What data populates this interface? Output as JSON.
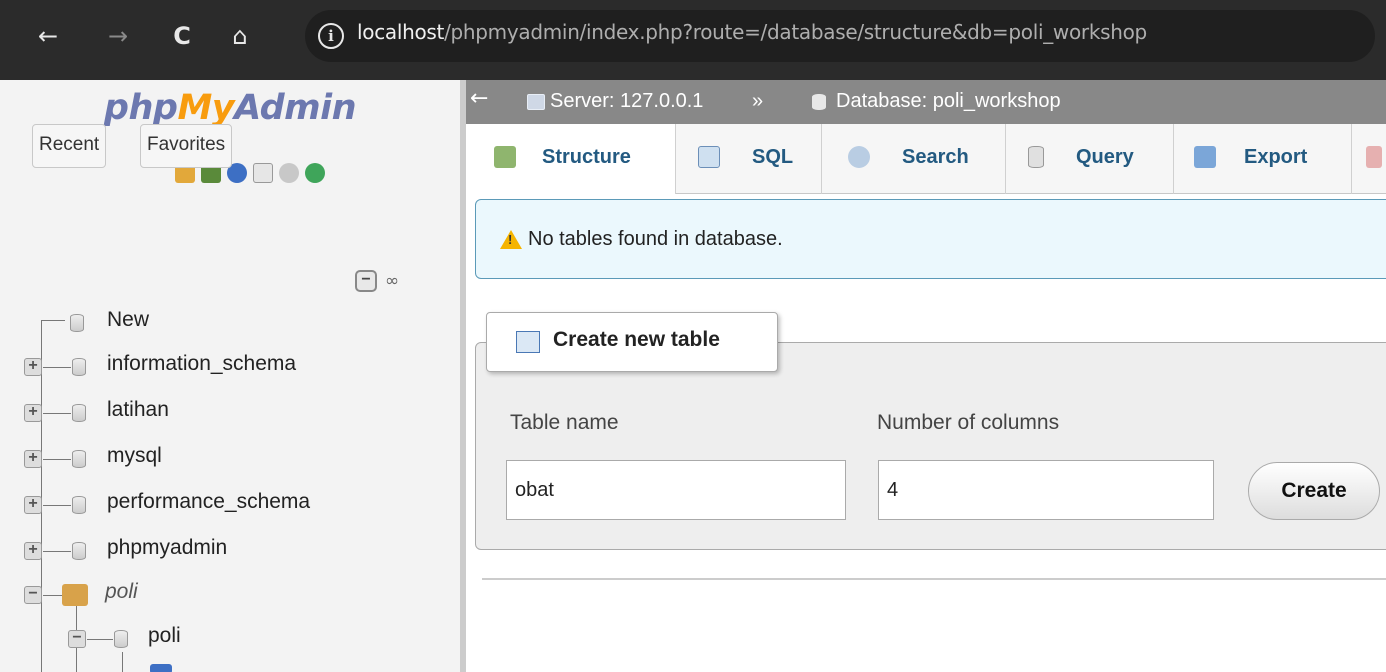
{
  "browser": {
    "back_icon": "←",
    "forward_icon": "→",
    "reload_icon": "C",
    "home_icon": "⌂",
    "info_icon": "i",
    "url_host": "localhost",
    "url_path": "/phpmyadmin/index.php?route=/database/structure&db=poli_workshop"
  },
  "sidebar": {
    "logo_php": "php",
    "logo_my": "My",
    "logo_admin": "Admin",
    "tabs": [
      {
        "label": "Recent"
      },
      {
        "label": "Favorites"
      }
    ],
    "collapse_label": "−",
    "link_label": "∞",
    "tree": [
      {
        "label": "New"
      },
      {
        "label": "information_schema"
      },
      {
        "label": "latihan"
      },
      {
        "label": "mysql"
      },
      {
        "label": "performance_schema"
      },
      {
        "label": "phpmyadmin"
      },
      {
        "label": "poli"
      },
      {
        "label": "poli"
      }
    ]
  },
  "breadcrumb": {
    "server": "Server: 127.0.0.1",
    "separator": "»",
    "database": "Database: poli_workshop"
  },
  "tabs": [
    {
      "label": "Structure",
      "active": true
    },
    {
      "label": "SQL"
    },
    {
      "label": "Search"
    },
    {
      "label": "Query"
    },
    {
      "label": "Export"
    }
  ],
  "notice": {
    "warning_mark": "!",
    "text": "No tables found in database."
  },
  "create_table": {
    "legend": "Create new table",
    "table_name_label": "Table name",
    "table_name_value": "obat",
    "columns_label": "Number of columns",
    "columns_value": "4",
    "create_button": "Create"
  },
  "colors": {
    "brand_blue": "#6c78af",
    "brand_orange": "#f89c0e",
    "link_blue": "#235a81",
    "notice_bg": "#ebf8fd"
  }
}
